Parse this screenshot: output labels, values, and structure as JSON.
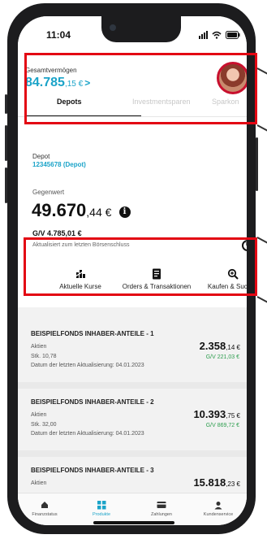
{
  "status_bar": {
    "time": "11:04"
  },
  "header": {
    "total_label": "Gesamtvermögen",
    "total_main": "84.785",
    "total_cents": ",15 €",
    "total_chevron": ">",
    "tabs": [
      {
        "label": "Depots",
        "active": true
      },
      {
        "label": "Investmentsparen",
        "active": false
      },
      {
        "label": "Sparkon",
        "active": false
      }
    ]
  },
  "depot": {
    "label": "Depot",
    "value": "12345678 (Depot)",
    "gegenwert_label": "Gegenwert",
    "gegenwert_main": "49.670",
    "gegenwert_cents": ",44",
    "gegenwert_currency": " €",
    "gv_label": "G/V",
    "gv_value": "4.785,01 €",
    "updated_text": "Aktualisiert zum letzten Börsenschluss"
  },
  "actions": [
    {
      "label": "Aktuelle Kurse",
      "icon": "chart-icon"
    },
    {
      "label": "Orders & Transaktionen",
      "icon": "document-icon"
    },
    {
      "label": "Kaufen & Suchen",
      "icon": "search-icon"
    }
  ],
  "holdings": [
    {
      "name": "BEISPIELFONDS INHABER-ANTEILE - 1",
      "kind": "Aktien",
      "stk": "Stk. 10,78",
      "date": "Datum der letzten Aktualisierung: 04.01.2023",
      "price_main": "2.358",
      "price_cents": ",14 €",
      "gain": "G/V  221,03 €"
    },
    {
      "name": "BEISPIELFONDS INHABER-ANTEILE - 2",
      "kind": "Aktien",
      "stk": "Stk. 32,00",
      "date": "Datum der letzten Aktualisierung: 04.01.2023",
      "price_main": "10.393",
      "price_cents": ",75 €",
      "gain": "G/V  869,72 €"
    },
    {
      "name": "BEISPIELFONDS INHABER-ANTEILE - 3",
      "kind": "Aktien",
      "stk": "",
      "date": "",
      "price_main": "15.818",
      "price_cents": ",23 €",
      "gain": ""
    }
  ],
  "bottom_nav": [
    {
      "label": "Finanzstatus",
      "icon": "home-icon",
      "active": false
    },
    {
      "label": "Produkte",
      "icon": "products-icon",
      "active": true
    },
    {
      "label": "Zahlungen",
      "icon": "payments-icon",
      "active": false
    },
    {
      "label": "Kundenservice",
      "icon": "service-icon",
      "active": false
    }
  ],
  "colors": {
    "accent": "#1aa3c8",
    "highlight": "#e30613",
    "gain": "#2e9e4f"
  }
}
